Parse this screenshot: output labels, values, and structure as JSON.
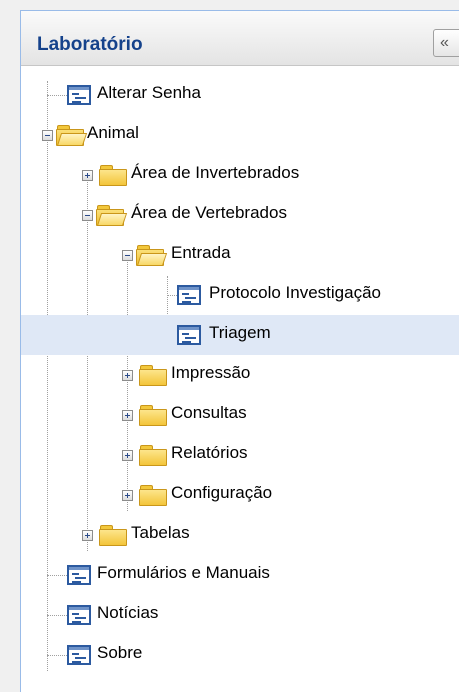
{
  "panel": {
    "title": "Laboratório",
    "collapse_label": "«"
  },
  "tree": {
    "alterar_senha": "Alterar Senha",
    "animal": "Animal",
    "area_invertebrados": "Área de Invertebrados",
    "area_vertebrados": "Área de Vertebrados",
    "entrada": "Entrada",
    "protocolo": "Protocolo Investigação",
    "triagem": "Triagem",
    "impressao": "Impressão",
    "consultas": "Consultas",
    "relatorios": "Relatórios",
    "configuracao": "Configuração",
    "tabelas": "Tabelas",
    "formularios": "Formulários e Manuais",
    "noticias": "Notícias",
    "sobre": "Sobre"
  },
  "selected_item": "Triagem",
  "colors": {
    "selection": "#dfe8f6",
    "title": "#15428b",
    "folder": "#f3c53a"
  }
}
